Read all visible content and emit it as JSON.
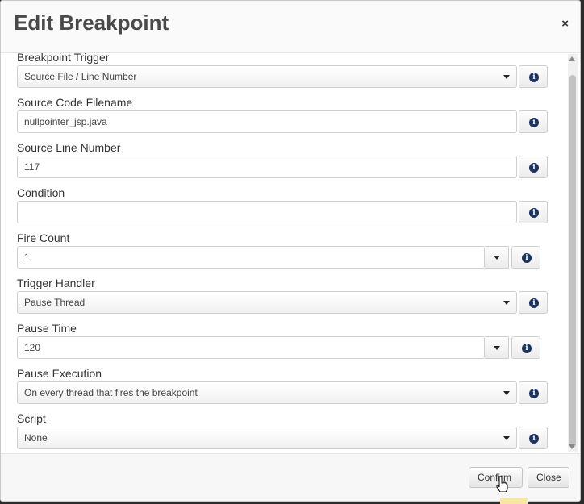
{
  "dialog": {
    "title": "Edit Breakpoint",
    "close_symbol": "×"
  },
  "fields": {
    "breakpoint_trigger": {
      "label": "Breakpoint Trigger",
      "value": "Source File / Line Number"
    },
    "source_code_filename": {
      "label": "Source Code Filename",
      "value": "nullpointer_jsp.java"
    },
    "source_line_number": {
      "label": "Source Line Number",
      "value": "117"
    },
    "condition": {
      "label": "Condition",
      "value": ""
    },
    "fire_count": {
      "label": "Fire Count",
      "value": "1"
    },
    "trigger_handler": {
      "label": "Trigger Handler",
      "value": "Pause Thread"
    },
    "pause_time": {
      "label": "Pause Time",
      "value": "120"
    },
    "pause_execution": {
      "label": "Pause Execution",
      "value": "On every thread that fires the breakpoint"
    },
    "script": {
      "label": "Script",
      "value": "None"
    }
  },
  "info_glyph": "i",
  "footer": {
    "confirm_label": "Confirm",
    "close_label": "Close"
  }
}
